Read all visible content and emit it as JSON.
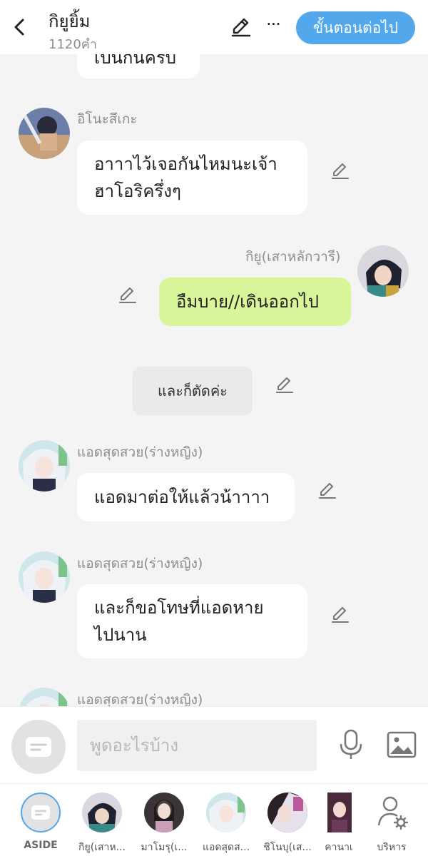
{
  "header": {
    "title": "กิยูยิ้ม",
    "word_count": "1120คำ",
    "more_label": "···",
    "next_button": "ขั้นตอนต่อไป",
    "accent": "#53a8ec"
  },
  "messages": [
    {
      "type": "left-partial",
      "text": "เป็นกันครับ"
    },
    {
      "type": "left",
      "sender": "อิโนะสึเกะ",
      "lines": [
        "อาาาไว้เจอกันไหมนะเจ้า",
        "ฮาโอริครึ่งๆ"
      ]
    },
    {
      "type": "right",
      "sender": "กิยู(เสาหลักวารี)",
      "text": "อืมบาย//เดินออกไป",
      "color": "#d9f59a"
    },
    {
      "type": "narration",
      "text": "และก็ตัดค่ะ"
    },
    {
      "type": "left",
      "sender": "แอดสุดสวย(ร่างหญิง)",
      "lines": [
        "แอดมาต่อให้แล้วน้าาาา"
      ]
    },
    {
      "type": "left",
      "sender": "แอดสุดสวย(ร่างหญิง)",
      "lines": [
        "และก็ขอโทษที่แอดหาย",
        "ไปนาน"
      ]
    },
    {
      "type": "left-sender-only",
      "sender": "แอดสุดสวย(ร่างหญิง)"
    }
  ],
  "input": {
    "placeholder": "พูดอะไรบ้าง"
  },
  "characters": [
    {
      "label": "ASIDE"
    },
    {
      "label": "กิยู(เสาห..."
    },
    {
      "label": "มาโมรุ(เ..."
    },
    {
      "label": "แอดสุดส..."
    },
    {
      "label": "ชิโนบุ(เส..."
    },
    {
      "label": "คานาเ"
    },
    {
      "label": "บริหาร"
    }
  ]
}
